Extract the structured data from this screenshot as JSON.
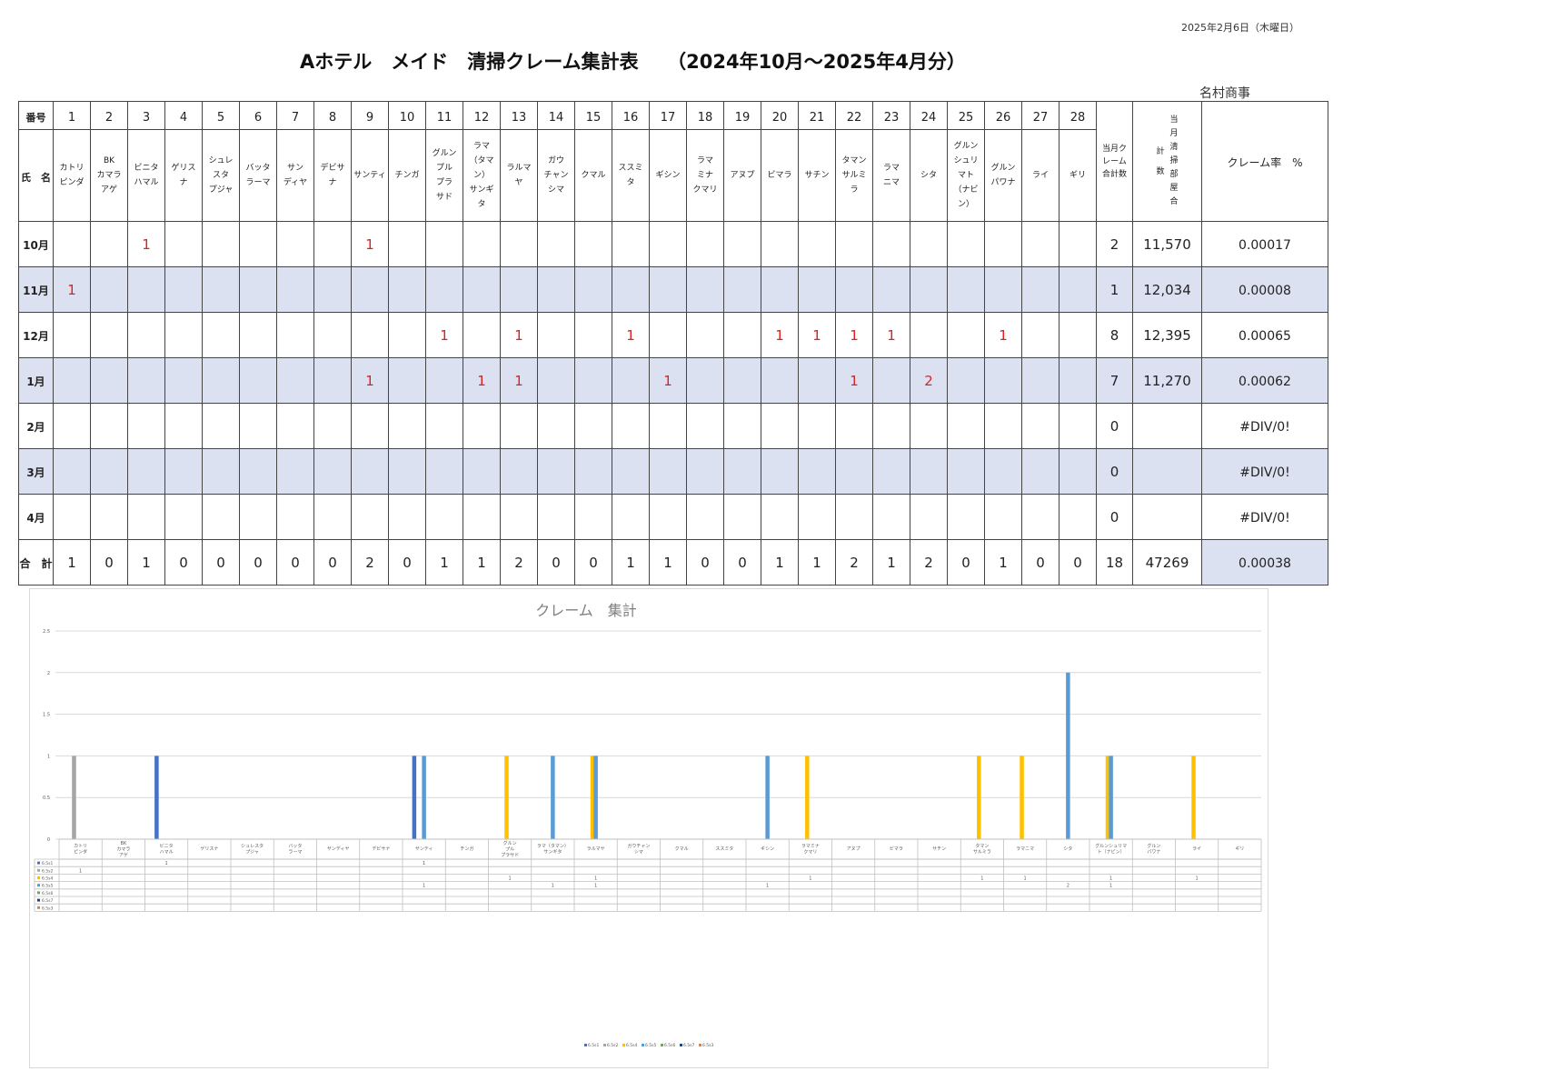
{
  "date": "2025年2月6日（木曜日）",
  "title": "Aホテル　メイド　清掃クレーム集計表　　（2024年10月～2025年4月分）",
  "company": "名村商事",
  "table": {
    "num_label": "番号",
    "name_label": "氏　名",
    "monthly_total_label": [
      "当月ク",
      "レーム",
      "合計数"
    ],
    "rooms_label": [
      "当",
      "月",
      "清",
      "掃",
      "部",
      "屋",
      "合"
    ],
    "rooms_prefix": [
      "計",
      "数"
    ],
    "rate_label": "クレーム率　%",
    "total_label": "合　計",
    "staff": [
      {
        "n": "1",
        "lines": [
          "カトリ",
          "ピンダ"
        ]
      },
      {
        "n": "2",
        "lines": [
          "BK",
          "カマラ",
          "アゲ"
        ]
      },
      {
        "n": "3",
        "lines": [
          "ビニタ",
          "ハマル"
        ]
      },
      {
        "n": "4",
        "lines": [
          "ゲリス",
          "ナ"
        ]
      },
      {
        "n": "5",
        "lines": [
          "シュレ",
          "スタ",
          "プジャ"
        ]
      },
      {
        "n": "6",
        "lines": [
          "バッタ",
          "ラーマ"
        ]
      },
      {
        "n": "7",
        "lines": [
          "サン",
          "ディヤ"
        ]
      },
      {
        "n": "8",
        "lines": [
          "デビサ",
          "ナ"
        ]
      },
      {
        "n": "9",
        "lines": [
          "サンティ"
        ]
      },
      {
        "n": "10",
        "lines": [
          "チンガ"
        ]
      },
      {
        "n": "11",
        "lines": [
          "グルン",
          "プル",
          "プラ",
          "サド"
        ]
      },
      {
        "n": "12",
        "lines": [
          "ラマ",
          "（タマ",
          "ン）",
          "サンギ",
          "タ"
        ]
      },
      {
        "n": "13",
        "lines": [
          "ラルマ",
          "ヤ"
        ]
      },
      {
        "n": "14",
        "lines": [
          "ガウ",
          "チャン",
          "シマ"
        ]
      },
      {
        "n": "15",
        "lines": [
          "クマル"
        ]
      },
      {
        "n": "16",
        "lines": [
          "ススミ",
          "タ"
        ]
      },
      {
        "n": "17",
        "lines": [
          "ギシン"
        ]
      },
      {
        "n": "18",
        "lines": [
          "ラマ",
          "ミナ",
          "クマリ"
        ]
      },
      {
        "n": "19",
        "lines": [
          "アヌプ"
        ]
      },
      {
        "n": "20",
        "lines": [
          "ビマラ"
        ]
      },
      {
        "n": "21",
        "lines": [
          "サチン"
        ]
      },
      {
        "n": "22",
        "lines": [
          "タマン",
          "サルミ",
          "ラ"
        ]
      },
      {
        "n": "23",
        "lines": [
          "ラマ",
          "ニマ"
        ]
      },
      {
        "n": "24",
        "lines": [
          "シタ"
        ]
      },
      {
        "n": "25",
        "lines": [
          "グルン",
          "シュリ",
          "マト",
          "（ナビ",
          "ン）"
        ]
      },
      {
        "n": "26",
        "lines": [
          "グルン",
          "パワナ"
        ]
      },
      {
        "n": "27",
        "lines": [
          "ライ"
        ]
      },
      {
        "n": "28",
        "lines": [
          "ギリ"
        ]
      }
    ],
    "months": [
      {
        "label": "10月",
        "cells": {
          "3": "1",
          "9": "1"
        },
        "total": "2",
        "rooms": "11,570",
        "rate": "0.00017",
        "band": false
      },
      {
        "label": "11月",
        "cells": {
          "1": "1"
        },
        "total": "1",
        "rooms": "12,034",
        "rate": "0.00008",
        "band": true
      },
      {
        "label": "12月",
        "cells": {
          "11": "1",
          "13": "1",
          "16": "1",
          "20": "1",
          "21": "1",
          "22": "1",
          "23": "1",
          "26": "1"
        },
        "total": "8",
        "rooms": "12,395",
        "rate": "0.00065",
        "band": false
      },
      {
        "label": "1月",
        "cells": {
          "9": "1",
          "12": "1",
          "13": "1",
          "17": "1",
          "22": "1",
          "24": "2"
        },
        "total": "7",
        "rooms": "11,270",
        "rate": "0.00062",
        "band": true
      },
      {
        "label": "2月",
        "cells": {},
        "total": "0",
        "rooms": "",
        "rate": "#DIV/0!",
        "band": false
      },
      {
        "label": "3月",
        "cells": {},
        "total": "0",
        "rooms": "",
        "rate": "#DIV/0!",
        "band": true
      },
      {
        "label": "4月",
        "cells": {},
        "total": "0",
        "rooms": "",
        "rate": "#DIV/0!",
        "band": false
      }
    ],
    "totals": [
      "1",
      "0",
      "1",
      "0",
      "0",
      "0",
      "0",
      "0",
      "2",
      "0",
      "1",
      "1",
      "2",
      "0",
      "0",
      "1",
      "1",
      "0",
      "0",
      "1",
      "1",
      "2",
      "1",
      "2",
      "0",
      "1",
      "0",
      "0"
    ],
    "grand_total": "18",
    "grand_rooms": "47269",
    "grand_rate": "0.00038"
  },
  "chart_data": {
    "type": "bar",
    "title": "クレーム　集計",
    "ylim": [
      0,
      2.5
    ],
    "yticks": [
      "0",
      "0.5",
      "1",
      "1.5",
      "2",
      "2.5"
    ],
    "categories": [
      "カトリピンダ",
      "BKカマラアゲ",
      "ビニタハマル",
      "ゲリスナ",
      "シュレスタプジャ",
      "バッタラーマ",
      "サンディヤ",
      "デビサナ",
      "サンティ",
      "チンガ",
      "グルンプルプラサド",
      "ラマ（タマン）サンギタ",
      "ラルマヤ",
      "ガウチャンシマ",
      "クマル",
      "ススミタ",
      "ギシン",
      "ラマミナクマリ",
      "アヌプ",
      "ビマラ",
      "サチン",
      "タマンサルミラ",
      "ラマニマ",
      "シタ",
      "グルンシュリマト（ナビン）",
      "グルンパワナ",
      "ライ",
      "ギリ"
    ],
    "category_lines": [
      [
        "カトリ",
        "ピンダ"
      ],
      [
        "BK",
        "カマラ",
        "アゲ"
      ],
      [
        "ビニタ",
        "ハマル"
      ],
      [
        "ゲリスナ"
      ],
      [
        "シュレスタ",
        "プジャ"
      ],
      [
        "バッタ",
        "ラーマ"
      ],
      [
        "サンディヤ"
      ],
      [
        "デビサナ"
      ],
      [
        "サンティ"
      ],
      [
        "チンガ"
      ],
      [
        "グルン",
        "プル",
        "プラサド"
      ],
      [
        "ラマ（タマン）",
        "サンギタ"
      ],
      [
        "ラルマヤ"
      ],
      [
        "ガウチャン",
        "シマ"
      ],
      [
        "クマル"
      ],
      [
        "ススミタ"
      ],
      [
        "ギシン"
      ],
      [
        "ラマミナ",
        "クマリ"
      ],
      [
        "アヌプ"
      ],
      [
        "ビマラ"
      ],
      [
        "サチン"
      ],
      [
        "タマン",
        "サルミラ"
      ],
      [
        "ラマニマ"
      ],
      [
        "シタ"
      ],
      [
        "グルンシュリマ",
        "ト（ナビン）"
      ],
      [
        "グルン",
        "パワナ"
      ],
      [
        "ライ"
      ],
      [
        "ギリ"
      ]
    ],
    "series": [
      {
        "name": "6.5s1",
        "color": "#4472c4",
        "values": [
          0,
          0,
          1,
          0,
          0,
          0,
          0,
          0,
          1,
          0,
          0,
          0,
          0,
          0,
          0,
          0,
          0,
          0,
          0,
          0,
          0,
          0,
          0,
          0,
          0,
          0,
          0,
          0
        ]
      },
      {
        "name": "6.5s2",
        "color": "#a5a5a5",
        "values": [
          1,
          0,
          0,
          0,
          0,
          0,
          0,
          0,
          0,
          0,
          0,
          0,
          0,
          0,
          0,
          0,
          0,
          0,
          0,
          0,
          0,
          0,
          0,
          0,
          0,
          0,
          0,
          0
        ]
      },
      {
        "name": "6.5s4",
        "color": "#ffc000",
        "values": [
          0,
          0,
          0,
          0,
          0,
          0,
          0,
          0,
          0,
          0,
          1,
          0,
          1,
          0,
          0,
          0,
          0,
          1,
          0,
          0,
          0,
          1,
          1,
          0,
          1,
          0,
          1,
          0
        ]
      },
      {
        "name": "6.5s5",
        "color": "#5b9bd5",
        "values": [
          0,
          0,
          0,
          0,
          0,
          0,
          0,
          0,
          1,
          0,
          0,
          1,
          1,
          0,
          0,
          0,
          1,
          0,
          0,
          0,
          0,
          0,
          0,
          2,
          1,
          0,
          0,
          0
        ]
      },
      {
        "name": "6.5s6",
        "color": "#70ad47",
        "values": [
          0,
          0,
          0,
          0,
          0,
          0,
          0,
          0,
          0,
          0,
          0,
          0,
          0,
          0,
          0,
          0,
          0,
          0,
          0,
          0,
          0,
          0,
          0,
          0,
          0,
          0,
          0,
          0
        ]
      },
      {
        "name": "6.5s7",
        "color": "#264478",
        "values": [
          0,
          0,
          0,
          0,
          0,
          0,
          0,
          0,
          0,
          0,
          0,
          0,
          0,
          0,
          0,
          0,
          0,
          0,
          0,
          0,
          0,
          0,
          0,
          0,
          0,
          0,
          0,
          0
        ]
      },
      {
        "name": "6.5s3",
        "color": "#ed7d31",
        "values": [
          0,
          0,
          0,
          0,
          0,
          0,
          0,
          0,
          0,
          0,
          0,
          0,
          0,
          0,
          0,
          0,
          0,
          0,
          0,
          0,
          0,
          0,
          0,
          0,
          0,
          0,
          0,
          0
        ]
      }
    ]
  }
}
